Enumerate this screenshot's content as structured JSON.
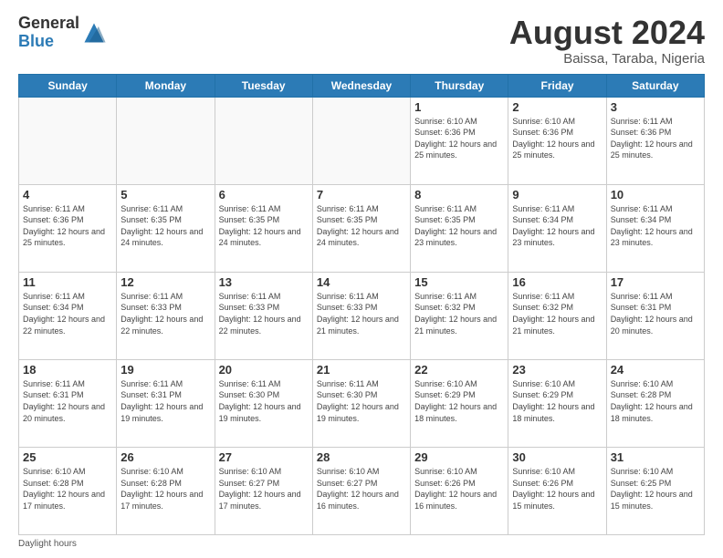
{
  "header": {
    "logo_line1": "General",
    "logo_line2": "Blue",
    "month_year": "August 2024",
    "location": "Baissa, Taraba, Nigeria"
  },
  "days_of_week": [
    "Sunday",
    "Monday",
    "Tuesday",
    "Wednesday",
    "Thursday",
    "Friday",
    "Saturday"
  ],
  "footer": {
    "note": "Daylight hours"
  },
  "weeks": [
    [
      {
        "day": "",
        "info": ""
      },
      {
        "day": "",
        "info": ""
      },
      {
        "day": "",
        "info": ""
      },
      {
        "day": "",
        "info": ""
      },
      {
        "day": "1",
        "info": "Sunrise: 6:10 AM\nSunset: 6:36 PM\nDaylight: 12 hours\nand 25 minutes."
      },
      {
        "day": "2",
        "info": "Sunrise: 6:10 AM\nSunset: 6:36 PM\nDaylight: 12 hours\nand 25 minutes."
      },
      {
        "day": "3",
        "info": "Sunrise: 6:11 AM\nSunset: 6:36 PM\nDaylight: 12 hours\nand 25 minutes."
      }
    ],
    [
      {
        "day": "4",
        "info": "Sunrise: 6:11 AM\nSunset: 6:36 PM\nDaylight: 12 hours\nand 25 minutes."
      },
      {
        "day": "5",
        "info": "Sunrise: 6:11 AM\nSunset: 6:35 PM\nDaylight: 12 hours\nand 24 minutes."
      },
      {
        "day": "6",
        "info": "Sunrise: 6:11 AM\nSunset: 6:35 PM\nDaylight: 12 hours\nand 24 minutes."
      },
      {
        "day": "7",
        "info": "Sunrise: 6:11 AM\nSunset: 6:35 PM\nDaylight: 12 hours\nand 24 minutes."
      },
      {
        "day": "8",
        "info": "Sunrise: 6:11 AM\nSunset: 6:35 PM\nDaylight: 12 hours\nand 23 minutes."
      },
      {
        "day": "9",
        "info": "Sunrise: 6:11 AM\nSunset: 6:34 PM\nDaylight: 12 hours\nand 23 minutes."
      },
      {
        "day": "10",
        "info": "Sunrise: 6:11 AM\nSunset: 6:34 PM\nDaylight: 12 hours\nand 23 minutes."
      }
    ],
    [
      {
        "day": "11",
        "info": "Sunrise: 6:11 AM\nSunset: 6:34 PM\nDaylight: 12 hours\nand 22 minutes."
      },
      {
        "day": "12",
        "info": "Sunrise: 6:11 AM\nSunset: 6:33 PM\nDaylight: 12 hours\nand 22 minutes."
      },
      {
        "day": "13",
        "info": "Sunrise: 6:11 AM\nSunset: 6:33 PM\nDaylight: 12 hours\nand 22 minutes."
      },
      {
        "day": "14",
        "info": "Sunrise: 6:11 AM\nSunset: 6:33 PM\nDaylight: 12 hours\nand 21 minutes."
      },
      {
        "day": "15",
        "info": "Sunrise: 6:11 AM\nSunset: 6:32 PM\nDaylight: 12 hours\nand 21 minutes."
      },
      {
        "day": "16",
        "info": "Sunrise: 6:11 AM\nSunset: 6:32 PM\nDaylight: 12 hours\nand 21 minutes."
      },
      {
        "day": "17",
        "info": "Sunrise: 6:11 AM\nSunset: 6:31 PM\nDaylight: 12 hours\nand 20 minutes."
      }
    ],
    [
      {
        "day": "18",
        "info": "Sunrise: 6:11 AM\nSunset: 6:31 PM\nDaylight: 12 hours\nand 20 minutes."
      },
      {
        "day": "19",
        "info": "Sunrise: 6:11 AM\nSunset: 6:31 PM\nDaylight: 12 hours\nand 19 minutes."
      },
      {
        "day": "20",
        "info": "Sunrise: 6:11 AM\nSunset: 6:30 PM\nDaylight: 12 hours\nand 19 minutes."
      },
      {
        "day": "21",
        "info": "Sunrise: 6:11 AM\nSunset: 6:30 PM\nDaylight: 12 hours\nand 19 minutes."
      },
      {
        "day": "22",
        "info": "Sunrise: 6:10 AM\nSunset: 6:29 PM\nDaylight: 12 hours\nand 18 minutes."
      },
      {
        "day": "23",
        "info": "Sunrise: 6:10 AM\nSunset: 6:29 PM\nDaylight: 12 hours\nand 18 minutes."
      },
      {
        "day": "24",
        "info": "Sunrise: 6:10 AM\nSunset: 6:28 PM\nDaylight: 12 hours\nand 18 minutes."
      }
    ],
    [
      {
        "day": "25",
        "info": "Sunrise: 6:10 AM\nSunset: 6:28 PM\nDaylight: 12 hours\nand 17 minutes."
      },
      {
        "day": "26",
        "info": "Sunrise: 6:10 AM\nSunset: 6:28 PM\nDaylight: 12 hours\nand 17 minutes."
      },
      {
        "day": "27",
        "info": "Sunrise: 6:10 AM\nSunset: 6:27 PM\nDaylight: 12 hours\nand 17 minutes."
      },
      {
        "day": "28",
        "info": "Sunrise: 6:10 AM\nSunset: 6:27 PM\nDaylight: 12 hours\nand 16 minutes."
      },
      {
        "day": "29",
        "info": "Sunrise: 6:10 AM\nSunset: 6:26 PM\nDaylight: 12 hours\nand 16 minutes."
      },
      {
        "day": "30",
        "info": "Sunrise: 6:10 AM\nSunset: 6:26 PM\nDaylight: 12 hours\nand 15 minutes."
      },
      {
        "day": "31",
        "info": "Sunrise: 6:10 AM\nSunset: 6:25 PM\nDaylight: 12 hours\nand 15 minutes."
      }
    ]
  ]
}
